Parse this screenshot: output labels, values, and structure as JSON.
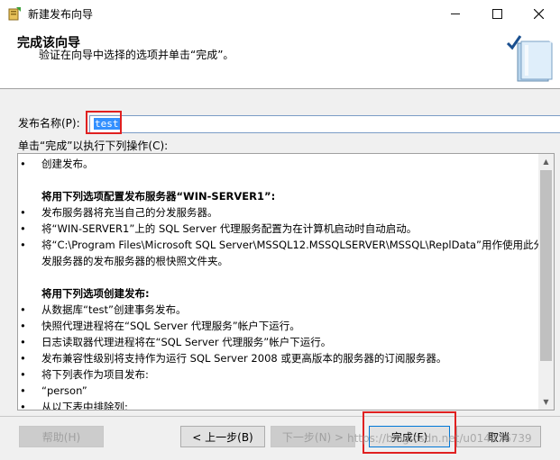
{
  "window": {
    "title": "新建发布向导"
  },
  "header": {
    "title": "完成该向导",
    "subtitle": "验证在向导中选择的选项并单击“完成”。"
  },
  "form": {
    "publication_name_label": "发布名称(P):",
    "publication_name_value": "test",
    "actions_label": "单击“完成”以执行下列操作(C):"
  },
  "summary": {
    "lines": [
      {
        "bullet": "•",
        "text": "创建发布。",
        "bold": false
      },
      {
        "bullet": "",
        "text": "",
        "bold": false
      },
      {
        "bullet": "",
        "text": "将用下列选项配置发布服务器“WIN-SERVER1”:",
        "bold": true
      },
      {
        "bullet": "•",
        "text": "发布服务器将充当自己的分发服务器。",
        "bold": false
      },
      {
        "bullet": "•",
        "text": "将“WIN-SERVER1”上的 SQL Server 代理服务配置为在计算机启动时自动启动。",
        "bold": false
      },
      {
        "bullet": "•",
        "text": "将“C:\\Program Files\\Microsoft SQL Server\\MSSQL12.MSSQLSERVER\\MSSQL\\ReplData”用作使用此分",
        "bold": false
      },
      {
        "bullet": "",
        "text": "发服务器的发布服务器的根快照文件夹。",
        "bold": false
      },
      {
        "bullet": "",
        "text": "",
        "bold": false
      },
      {
        "bullet": "",
        "text": "将用下列选项创建发布:",
        "bold": true
      },
      {
        "bullet": "•",
        "text": "从数据库“test”创建事务发布。",
        "bold": false
      },
      {
        "bullet": "•",
        "text": "快照代理进程将在“SQL Server 代理服务”帐户下运行。",
        "bold": false
      },
      {
        "bullet": "•",
        "text": "日志读取器代理进程将在“SQL Server 代理服务”帐户下运行。",
        "bold": false
      },
      {
        "bullet": "•",
        "text": "发布兼容性级别将支持作为运行 SQL Server 2008 或更高版本的服务器的订阅服务器。",
        "bold": false
      },
      {
        "bullet": "•",
        "text": "将下列表作为项目发布:",
        "bold": false
      },
      {
        "bullet": "    •",
        "text": "“person”",
        "bold": false
      },
      {
        "bullet": "•",
        "text": "从以下表中排除列:",
        "bold": false
      }
    ]
  },
  "buttons": {
    "help": "帮助(H)",
    "back": "< 上一步(B)",
    "next": "下一步(N) >",
    "finish": "完成(F)",
    "cancel": "取消"
  },
  "watermark": "https://blog.csdn.net/u014476739",
  "icons": {
    "app": "wizard-app-icon",
    "minimize": "minimize-icon",
    "maximize": "maximize-icon",
    "close": "close-icon",
    "graphic": "wizard-book-check-icon",
    "scroll_up": "scroll-up-arrow-icon",
    "scroll_down": "scroll-down-arrow-icon"
  },
  "colors": {
    "accent": "#0078d7",
    "highlight_box": "#e02020",
    "selection": "#3390ff"
  }
}
